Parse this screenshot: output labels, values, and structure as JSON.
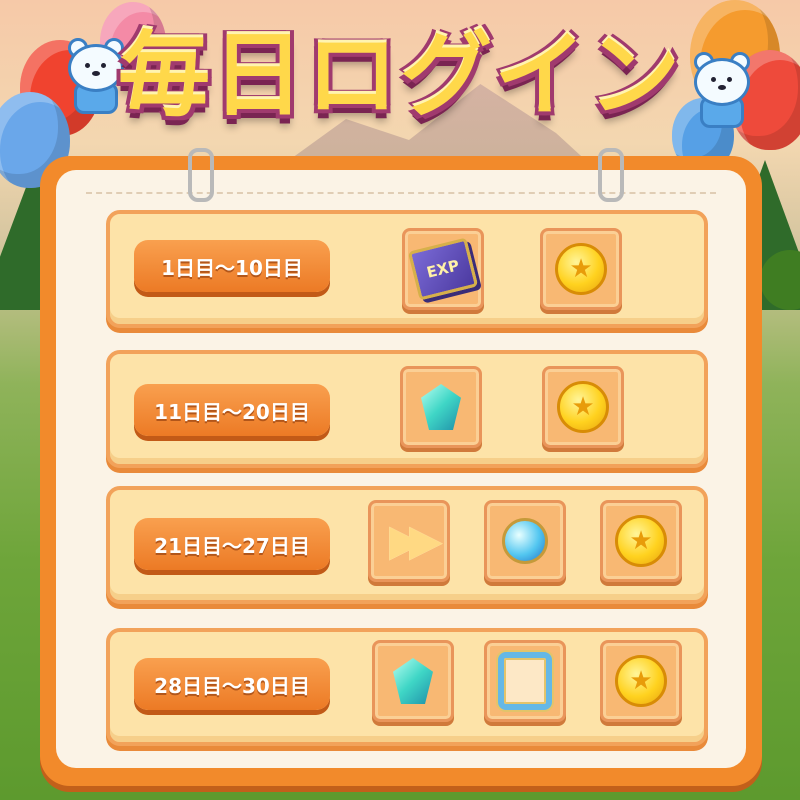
{
  "title": "毎日ログイン",
  "rows": [
    {
      "label": "1日目〜10日目",
      "rewards": [
        "exp-book-icon",
        "coin-icon"
      ]
    },
    {
      "label": "11日目〜20日目",
      "rewards": [
        "gem-icon",
        "coin-icon"
      ]
    },
    {
      "label": "21日目〜27日目",
      "rewards": [
        "fast-forward-icon",
        "potion-icon",
        "coin-icon"
      ]
    },
    {
      "label": "28日目〜30日目",
      "rewards": [
        "gem-icon",
        "avatar-frame-icon",
        "coin-icon"
      ]
    }
  ],
  "icons": {
    "exp_text": "EXP",
    "coin_glyph": "★",
    "ff_glyph": "▶▶"
  },
  "colors": {
    "title_fill": "#ffd84a",
    "title_outline": "#a03a6e",
    "board": "#f28a2b",
    "pill": "#ec7a25",
    "row_bg": "#fde3a8"
  }
}
